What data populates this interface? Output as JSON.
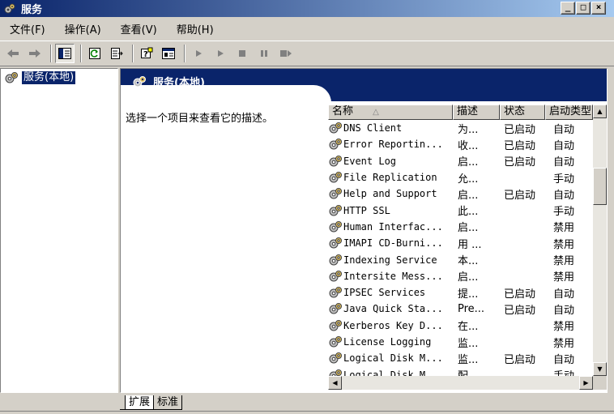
{
  "window": {
    "title": "服务",
    "min_label": "_",
    "max_label": "□",
    "close_label": "×"
  },
  "menu": [
    {
      "label": "文件(F)"
    },
    {
      "label": "操作(A)"
    },
    {
      "label": "查看(V)"
    },
    {
      "label": "帮助(H)"
    }
  ],
  "toolbar": [
    "back-arrow-icon",
    "forward-arrow-icon",
    "show-hide-tree-icon",
    "refresh-icon",
    "export-list-icon",
    "help-icon",
    "properties-icon",
    "start-icon",
    "start-alt-icon",
    "stop-icon",
    "pause-icon",
    "restart-icon"
  ],
  "tree": {
    "selected_label": "服务(本地)"
  },
  "panel": {
    "title": "服务(本地)",
    "description": "选择一个项目来查看它的描述。"
  },
  "columns": {
    "name": "名称",
    "desc": "描述",
    "status": "状态",
    "startup": "启动类型"
  },
  "services": [
    {
      "name": "DNS Client",
      "desc": "为...",
      "status": "已启动",
      "startup": "自动"
    },
    {
      "name": "Error Reportin...",
      "desc": "收...",
      "status": "已启动",
      "startup": "自动"
    },
    {
      "name": "Event Log",
      "desc": "启...",
      "status": "已启动",
      "startup": "自动"
    },
    {
      "name": "File Replication",
      "desc": "允...",
      "status": "",
      "startup": "手动"
    },
    {
      "name": "Help and Support",
      "desc": "启...",
      "status": "已启动",
      "startup": "自动"
    },
    {
      "name": "HTTP SSL",
      "desc": "此...",
      "status": "",
      "startup": "手动"
    },
    {
      "name": "Human Interfac...",
      "desc": "启...",
      "status": "",
      "startup": "禁用"
    },
    {
      "name": "IMAPI CD-Burni...",
      "desc": "用 ...",
      "status": "",
      "startup": "禁用"
    },
    {
      "name": "Indexing Service",
      "desc": "本...",
      "status": "",
      "startup": "禁用"
    },
    {
      "name": "Intersite Mess...",
      "desc": "启...",
      "status": "",
      "startup": "禁用"
    },
    {
      "name": "IPSEC Services",
      "desc": "提...",
      "status": "已启动",
      "startup": "自动"
    },
    {
      "name": "Java Quick Sta...",
      "desc": "Pre...",
      "status": "已启动",
      "startup": "自动"
    },
    {
      "name": "Kerberos Key D...",
      "desc": "在...",
      "status": "",
      "startup": "禁用"
    },
    {
      "name": "License Logging",
      "desc": "监...",
      "status": "",
      "startup": "禁用"
    },
    {
      "name": "Logical Disk M...",
      "desc": "监...",
      "status": "已启动",
      "startup": "自动"
    },
    {
      "name": "Logical Disk M...",
      "desc": "配...",
      "status": "",
      "startup": "手动"
    }
  ],
  "tabs": [
    {
      "label": "扩展"
    },
    {
      "label": "标准"
    }
  ]
}
